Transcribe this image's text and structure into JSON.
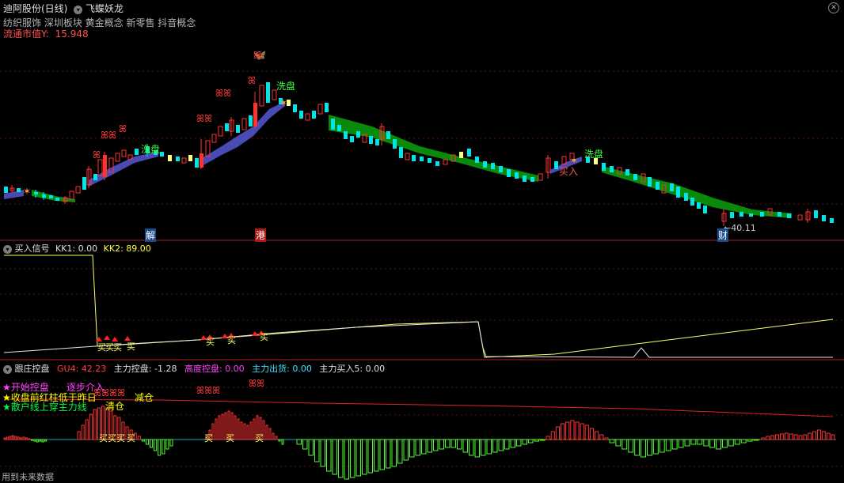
{
  "header": {
    "title": "迪阿股份(日线)",
    "indicator": "飞蝶妖龙",
    "concepts": "纺织服饰 深圳板块 黄金概念 新零售 抖音概念",
    "float_label": "流通市值Y:",
    "float_value": "15.948"
  },
  "main_panel": {
    "price_note": "←40.11",
    "markers": [
      "解",
      "港",
      "财"
    ],
    "annotations": {
      "wash1": "洗盘",
      "wash2": "洗盘",
      "wash3": "洗盘",
      "buy": "买入"
    }
  },
  "panel2": {
    "name": "买入信号",
    "kk1_label": "KK1:",
    "kk1_value": "0.00",
    "kk2_label": "KK2:",
    "kk2_value": "89.00",
    "buy_label": "买"
  },
  "panel3": {
    "name": "跟庄控盘",
    "gu4_label": "GU4:",
    "gu4_value": "42.23",
    "zlkp_label": "主力控盘:",
    "zlkp_value": "-1.28",
    "gdkp_label": "高度控盘:",
    "gdkp_value": "0.00",
    "zlch_label": "主力出货:",
    "zlch_value": "0.00",
    "zlmr_label": "主力买入5:",
    "zlmr_value": "0.00",
    "legend1": "开始控盘",
    "legend1b": "逐步介入",
    "legend2": "收盘前红柱低于昨日",
    "legend2b": "减仓",
    "legend3": "散户线上穿主力线",
    "legend3b": "清仓",
    "buy_label": "买"
  },
  "footer": {
    "text": "用到未来数据"
  },
  "colors": {
    "up": "#ff3232",
    "down": "#00e6e6",
    "ribbon_green": "#0a8a0a",
    "ribbon_blue": "#4a4ab4",
    "yellow": "#ffff00",
    "magenta": "#ff44ff"
  },
  "icons": [
    "settings-icon",
    "close-icon",
    "butterfly-icon",
    "star-icon",
    "arrow-up-icon"
  ]
}
